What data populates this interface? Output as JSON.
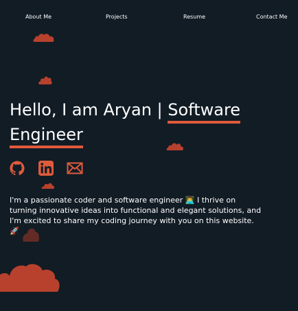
{
  "nav": {
    "items": [
      {
        "label": "About Me"
      },
      {
        "label": "Projects"
      },
      {
        "label": "Resume"
      },
      {
        "label": "Contact Me"
      }
    ]
  },
  "hero": {
    "greeting": "Hello, I am Aryan | ",
    "role_line1": "Software",
    "role_line2": "Engineer",
    "bio_part1": "I'm a passionate coder and software engineer ",
    "bio_emoji1": "👨‍💻",
    "bio_part2": " I thrive on turning innovative ideas into functional and elegant solutions, and I'm excited to share my coding journey with you on this website. ",
    "bio_emoji2": "🚀"
  },
  "social": {
    "icons": [
      "github-icon",
      "linkedin-icon",
      "mail-icon"
    ]
  },
  "colors": {
    "background": "#121c25",
    "accent": "#e05a3c",
    "cloud": "#b8412d",
    "text": "#ffffff"
  }
}
